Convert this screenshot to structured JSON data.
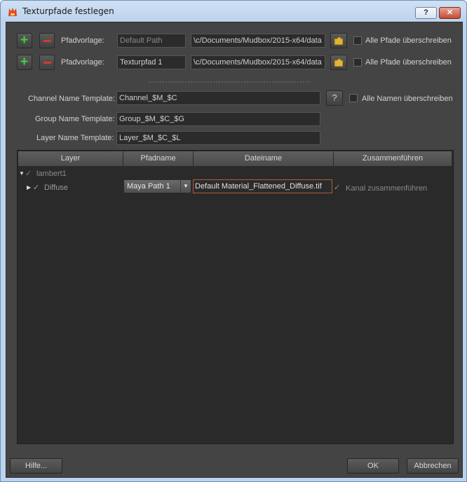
{
  "window": {
    "title": "Texturpfade festlegen",
    "help_glyph": "?",
    "close_glyph": "✕",
    "accent_color": "#c54b33"
  },
  "path_rows": [
    {
      "label": "Pfadvorlage:",
      "name": "Default Path",
      "path": "\\c/Documents/Mudbox/2015-x64/data",
      "overwrite_label": "Alle Pfade überschreiben"
    },
    {
      "label": "Pfadvorlage:",
      "name": "Texturpfad 1",
      "path": "\\c/Documents/Mudbox/2015-x64/data",
      "overwrite_label": "Alle Pfade überschreiben"
    }
  ],
  "templates": {
    "channel_label": "Channel Name Template:",
    "channel_value": "Channel_$M_$C",
    "group_label": "Group Name Template:",
    "group_value": "Group_$M_$C_$G",
    "layer_label": "Layer Name Template:",
    "layer_value": "Layer_$M_$C_$L",
    "help_glyph": "?",
    "overwrite_names_label": "Alle Namen überschreiben"
  },
  "table": {
    "columns": [
      "Layer",
      "Pfadname",
      "Dateiname",
      "Zusammenführen"
    ],
    "rows": [
      {
        "indent": 0,
        "expanded": true,
        "name": "lambert1"
      },
      {
        "indent": 1,
        "expanded": false,
        "name": "Diffuse",
        "path_name": "Maya Path 1",
        "file_name": "Default Material_Flattened_Diffuse.tif",
        "merge_label": "Kanal zusammenführen"
      }
    ]
  },
  "footer": {
    "help_label": "Hilfe...",
    "ok_label": "OK",
    "cancel_label": "Abbrechen"
  }
}
